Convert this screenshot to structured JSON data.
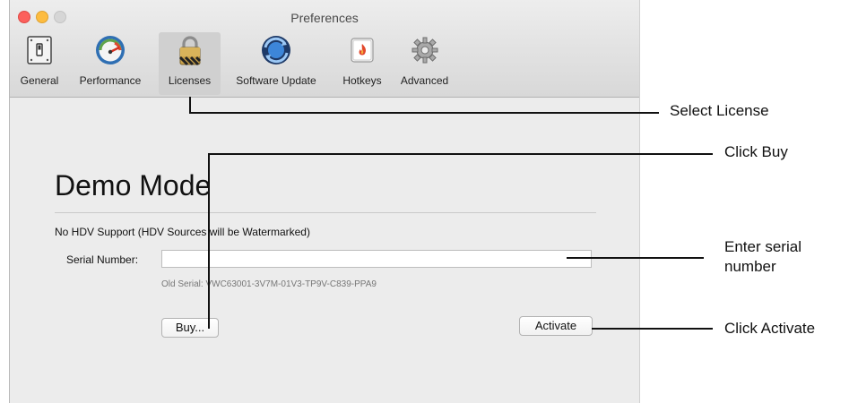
{
  "window": {
    "title": "Preferences"
  },
  "toolbar": {
    "items": [
      {
        "label": "General",
        "icon": "switch-icon"
      },
      {
        "label": "Performance",
        "icon": "speedometer-icon"
      },
      {
        "label": "Licenses",
        "icon": "padlock-icon"
      },
      {
        "label": "Software Update",
        "icon": "sync-arrows-icon"
      },
      {
        "label": "Hotkeys",
        "icon": "flame-key-icon"
      },
      {
        "label": "Advanced",
        "icon": "gears-icon"
      }
    ],
    "selected": "Licenses"
  },
  "license": {
    "heading": "Demo Mode",
    "note": "No HDV Support (HDV Sources will be Watermarked)",
    "serial_label": "Serial Number:",
    "serial_value": "",
    "old_serial": "Old Serial: VWC63001-3V7M-01V3-TP9V-C839-PPA9",
    "buy_label": "Buy...",
    "activate_label": "Activate"
  },
  "callouts": {
    "select_license": "Select License",
    "click_buy": "Click Buy",
    "enter_serial_1": "Enter serial",
    "enter_serial_2": "number",
    "click_activate": "Click Activate"
  }
}
